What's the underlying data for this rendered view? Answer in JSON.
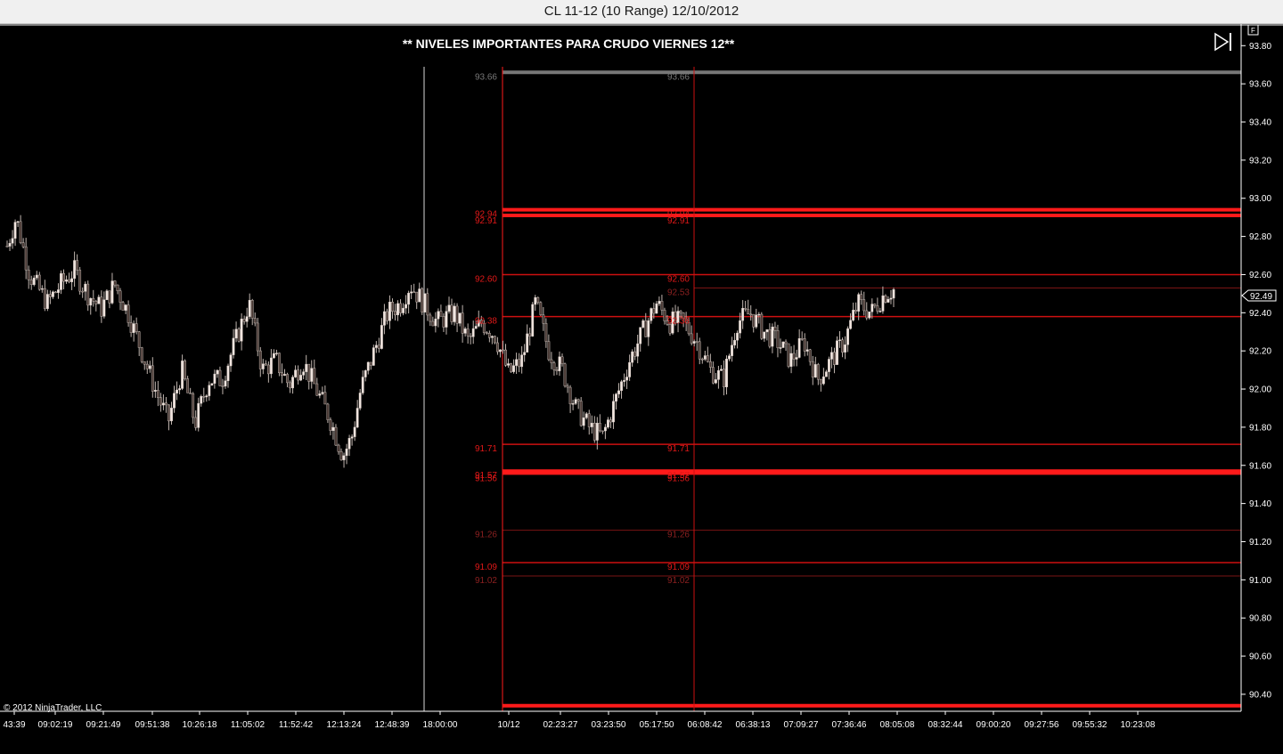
{
  "window": {
    "title": "CL 11-12 (10 Range)  12/10/2012"
  },
  "annotation": "** NIVELES IMPORTANTES PARA CRUDO VIERNES 12**",
  "copyright": "© 2012 NinjaTrader, LLC",
  "toolbar": {
    "f_button": "F"
  },
  "colors": {
    "background": "#000000",
    "axis": "#ffffff",
    "level_strong": "#ff1a1a",
    "level_medium": "#cc1010",
    "level_faint": "#7a1414",
    "level_gray": "#777777",
    "up_candle": "#f2e6e0",
    "down_candle": "#4a3a35"
  },
  "chart_data": {
    "type": "candlestick",
    "ylim": [
      90.32,
      93.85
    ],
    "y_ticks": [
      "93.80",
      "93.60",
      "93.40",
      "93.20",
      "93.00",
      "92.80",
      "92.60",
      "92.40",
      "92.20",
      "92.00",
      "91.80",
      "91.60",
      "91.40",
      "91.20",
      "91.00",
      "90.80",
      "90.60",
      "90.40"
    ],
    "y_tick_values": [
      93.8,
      93.6,
      93.4,
      93.2,
      93.0,
      92.8,
      92.6,
      92.4,
      92.2,
      92.0,
      91.8,
      91.6,
      91.4,
      91.2,
      91.0,
      90.8,
      90.6,
      90.4
    ],
    "x_ticks": [
      "43:39",
      "09:02:19",
      "09:21:49",
      "09:51:38",
      "10:26:18",
      "11:05:02",
      "11:52:42",
      "12:13:24",
      "12:48:39",
      "18:00:00",
      "10/12",
      "02:23:27",
      "03:23:50",
      "05:17:50",
      "06:08:42",
      "06:38:13",
      "07:09:27",
      "07:36:46",
      "08:05:08",
      "08:32:44",
      "09:00:20",
      "09:27:56",
      "09:55:32",
      "10:23:08"
    ],
    "current_price": "92.49",
    "close_path": [
      [
        0,
        92.75
      ],
      [
        0.02,
        92.9
      ],
      [
        0.05,
        92.6
      ],
      [
        0.09,
        92.45
      ],
      [
        0.12,
        92.55
      ],
      [
        0.15,
        92.62
      ],
      [
        0.18,
        92.5
      ],
      [
        0.21,
        92.42
      ],
      [
        0.24,
        92.55
      ],
      [
        0.27,
        92.4
      ],
      [
        0.3,
        92.2
      ],
      [
        0.33,
        92.0
      ],
      [
        0.36,
        91.83
      ],
      [
        0.39,
        92.1
      ],
      [
        0.42,
        91.82
      ],
      [
        0.45,
        92.05
      ],
      [
        0.48,
        92.05
      ],
      [
        0.51,
        92.25
      ],
      [
        0.54,
        92.45
      ],
      [
        0.57,
        92.1
      ],
      [
        0.6,
        92.15
      ],
      [
        0.63,
        92.02
      ],
      [
        0.66,
        92.15
      ],
      [
        0.69,
        92.0
      ],
      [
        0.72,
        91.85
      ],
      [
        0.75,
        91.65
      ],
      [
        0.77,
        91.75
      ],
      [
        0.79,
        92.0
      ],
      [
        0.82,
        92.2
      ],
      [
        0.85,
        92.4
      ],
      [
        0.88,
        92.45
      ],
      [
        0.9,
        92.55
      ],
      [
        0.93,
        92.45
      ],
      [
        0.96,
        92.35
      ],
      [
        1.0,
        92.4
      ],
      [
        1.03,
        92.25
      ],
      [
        1.06,
        92.35
      ],
      [
        1.09,
        92.28
      ],
      [
        1.12,
        92.08
      ],
      [
        1.15,
        92.15
      ],
      [
        1.18,
        92.45
      ],
      [
        1.21,
        92.2
      ],
      [
        1.24,
        92.1
      ],
      [
        1.27,
        91.9
      ],
      [
        1.3,
        91.8
      ],
      [
        1.33,
        91.75
      ],
      [
        1.36,
        91.95
      ],
      [
        1.39,
        92.15
      ],
      [
        1.42,
        92.3
      ],
      [
        1.45,
        92.45
      ],
      [
        1.48,
        92.35
      ],
      [
        1.51,
        92.35
      ],
      [
        1.54,
        92.25
      ],
      [
        1.57,
        92.1
      ],
      [
        1.6,
        92.05
      ],
      [
        1.63,
        92.35
      ],
      [
        1.66,
        92.4
      ],
      [
        1.69,
        92.3
      ],
      [
        1.72,
        92.25
      ],
      [
        1.75,
        92.15
      ],
      [
        1.78,
        92.25
      ],
      [
        1.81,
        92.05
      ],
      [
        1.84,
        92.15
      ],
      [
        1.87,
        92.25
      ],
      [
        1.9,
        92.45
      ],
      [
        1.93,
        92.4
      ],
      [
        1.96,
        92.5
      ],
      [
        1.98,
        92.52
      ]
    ],
    "levels": [
      {
        "value": 93.66,
        "label": "93.66",
        "style": "gray"
      },
      {
        "value": 92.94,
        "label": "92.94",
        "style": "strong"
      },
      {
        "value": 92.91,
        "label": "92.91",
        "style": "strong"
      },
      {
        "value": 92.6,
        "label": "92.60",
        "style": "medium"
      },
      {
        "value": 92.53,
        "label": "92.53",
        "style": "faint"
      },
      {
        "value": 92.38,
        "label": "92.38",
        "style": "medium"
      },
      {
        "value": 91.71,
        "label": "91.71",
        "style": "medium"
      },
      {
        "value": 91.57,
        "label": "91.57",
        "style": "strong"
      },
      {
        "value": 91.56,
        "label": "91.56",
        "style": "strong"
      },
      {
        "value": 91.26,
        "label": "91.26",
        "style": "faint"
      },
      {
        "value": 91.09,
        "label": "91.09",
        "style": "medium"
      },
      {
        "value": 91.02,
        "label": "91.02",
        "style": "faint"
      },
      {
        "value": 90.34,
        "label": "",
        "style": "strong"
      }
    ]
  }
}
